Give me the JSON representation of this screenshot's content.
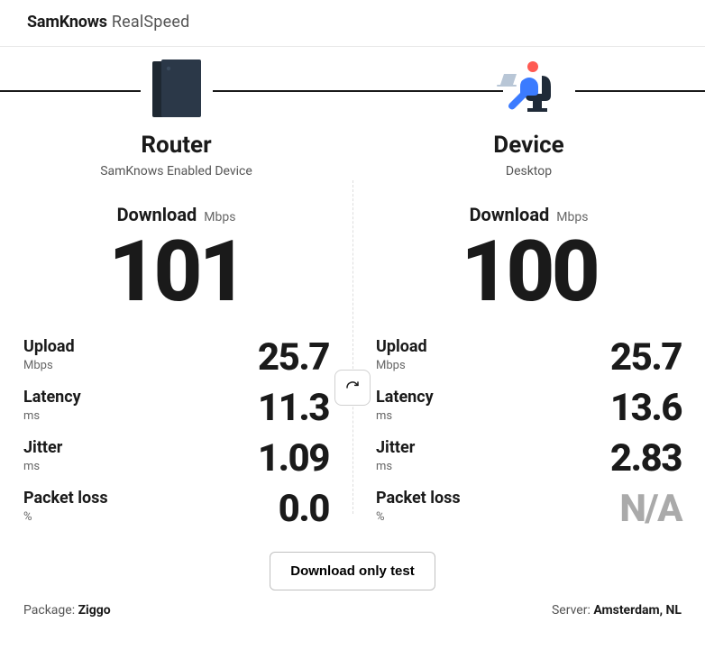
{
  "brand": {
    "bold": "SamKnows",
    "light": "RealSpeed"
  },
  "router": {
    "title": "Router",
    "subtitle": "SamKnows Enabled Device",
    "download_label": "Download",
    "download_unit": "Mbps",
    "download_value": "101",
    "metrics": {
      "upload_label": "Upload",
      "upload_unit": "Mbps",
      "upload_value": "25.7",
      "latency_label": "Latency",
      "latency_unit": "ms",
      "latency_value": "11.3",
      "jitter_label": "Jitter",
      "jitter_unit": "ms",
      "jitter_value": "1.09",
      "packetloss_label": "Packet loss",
      "packetloss_unit": "%",
      "packetloss_value": "0.0"
    }
  },
  "device": {
    "title": "Device",
    "subtitle": "Desktop",
    "download_label": "Download",
    "download_unit": "Mbps",
    "download_value": "100",
    "metrics": {
      "upload_label": "Upload",
      "upload_unit": "Mbps",
      "upload_value": "25.7",
      "latency_label": "Latency",
      "latency_unit": "ms",
      "latency_value": "13.6",
      "jitter_label": "Jitter",
      "jitter_unit": "ms",
      "jitter_value": "2.83",
      "packetloss_label": "Packet loss",
      "packetloss_unit": "%",
      "packetloss_value": "N/A"
    }
  },
  "actions": {
    "download_only": "Download only test"
  },
  "footer": {
    "package_label": "Package: ",
    "package_value": "Ziggo",
    "server_label": "Server: ",
    "server_value": "Amsterdam, NL"
  }
}
